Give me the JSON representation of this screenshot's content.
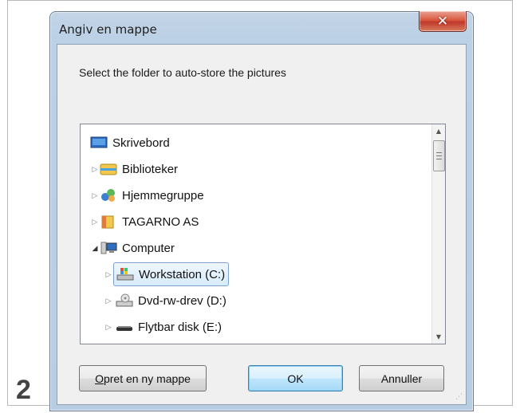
{
  "step": "2",
  "dialog": {
    "title": "Angiv en mappe",
    "instruction": "Select the folder to auto-store the pictures"
  },
  "tree": {
    "items": [
      {
        "label": "Skrivebord",
        "icon": "desktop-icon"
      },
      {
        "label": "Biblioteker",
        "icon": "libraries-icon"
      },
      {
        "label": "Hjemmegruppe",
        "icon": "homegroup-icon"
      },
      {
        "label": "TAGARNO AS",
        "icon": "user-folder-icon"
      },
      {
        "label": "Computer",
        "icon": "computer-icon"
      },
      {
        "label": "Workstation (C:)",
        "icon": "drive-c-icon",
        "selected": true
      },
      {
        "label": "Dvd-rw-drev (D:)",
        "icon": "dvd-drive-icon"
      },
      {
        "label": "Flytbar disk (E:)",
        "icon": "removable-disk-icon"
      }
    ]
  },
  "buttons": {
    "new_folder_mnemonic": "O",
    "new_folder_rest": "pret en ny mappe",
    "ok": "OK",
    "cancel": "Annuller"
  },
  "colors": {
    "title_bar": "#bdd1e6",
    "close_button": "#c0392b",
    "selection": "#d6ebfc"
  }
}
